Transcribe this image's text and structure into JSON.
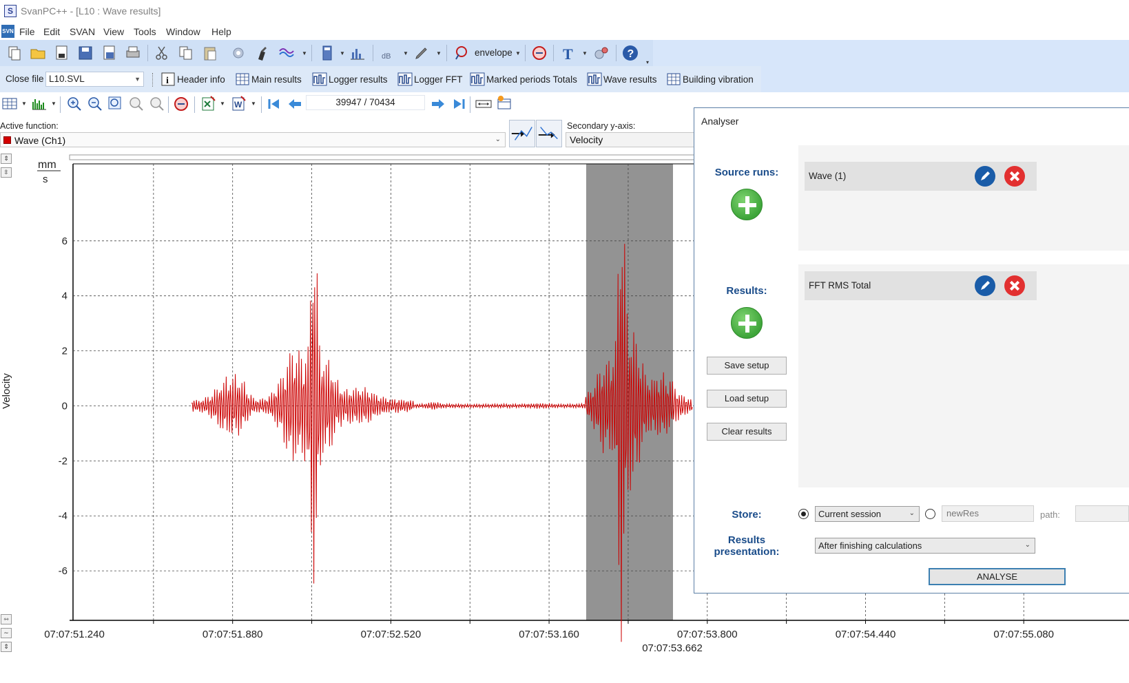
{
  "window": {
    "title": "SvanPC++ - [L10 : Wave results]"
  },
  "menu": [
    "File",
    "Edit",
    "SVAN",
    "View",
    "Tools",
    "Window",
    "Help"
  ],
  "toolbar1": {
    "envelope_label": "envelope"
  },
  "toolbar2": {
    "close_file_label": "Close file",
    "file_value": "L10.SVL",
    "buttons": [
      "Header info",
      "Main results",
      "Logger results",
      "Logger FFT",
      "Marked periods Totals",
      "Wave results",
      "Building vibration"
    ]
  },
  "toolbar3": {
    "counter": "39947 / 70434"
  },
  "active_function": {
    "label": "Active function:",
    "value": "Wave (Ch1)",
    "color": "#d40000"
  },
  "secondary_axis": {
    "label": "Secondary y-axis:",
    "value": "Velocity"
  },
  "chart_data": {
    "type": "line",
    "ylabel": "Velocity",
    "yunit_top": "mm",
    "yunit_bottom": "s",
    "ylim": [
      -7.8,
      8.8
    ],
    "yticks": [
      6,
      4,
      2,
      0,
      -2,
      -4,
      -6
    ],
    "ytick_labels": [
      "6",
      "4",
      "2",
      "0",
      "-2",
      "-4",
      "-6"
    ],
    "xticks": [
      "07:07:51.240",
      "07:07:51.880",
      "07:07:52.520",
      "07:07:53.160",
      "07:07:53.800",
      "07:07:54.440",
      "07:07:55.080"
    ],
    "marker_label": "07:07:53.662",
    "grid": true,
    "series": [
      {
        "color": "#cc0000"
      }
    ]
  },
  "analyser": {
    "title": "Analyser",
    "source_runs_label": "Source runs:",
    "results_label": "Results:",
    "source_runs": [
      "Wave (1)"
    ],
    "results": [
      "FFT RMS Total"
    ],
    "save_setup": "Save setup",
    "load_setup": "Load setup",
    "clear_results": "Clear results",
    "store_label": "Store:",
    "store_option": "Current session",
    "name_value": "newRes",
    "path_label": "path:",
    "presentation_label_1": "Results",
    "presentation_label_2": "presentation:",
    "presentation_option": "After finishing calculations",
    "analyse_button": "ANALYSE"
  }
}
